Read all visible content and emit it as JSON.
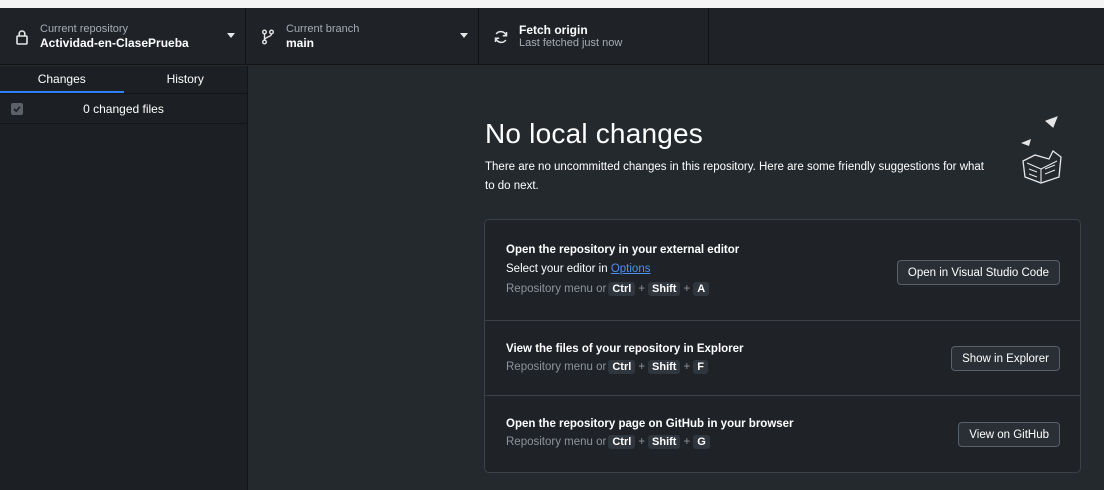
{
  "toolbar": {
    "repo": {
      "label": "Current repository",
      "value": "Actividad-en-ClasePrueba"
    },
    "branch": {
      "label": "Current branch",
      "value": "main"
    },
    "fetch": {
      "label": "Fetch origin",
      "value": "Last fetched just now"
    }
  },
  "sidebar": {
    "tabs": [
      {
        "label": "Changes",
        "active": true
      },
      {
        "label": "History",
        "active": false
      }
    ],
    "changes_label": "0 changed files"
  },
  "main": {
    "heading": "No local changes",
    "subtext": "There are no uncommitted changes in this repository. Here are some friendly suggestions for what to do next.",
    "suggestions": [
      {
        "title": "Open the repository in your external editor",
        "line_prefix": "Select your editor in ",
        "line_link": "Options",
        "hint_prefix": "Repository menu or",
        "keys": [
          "Ctrl",
          "Shift",
          "A"
        ],
        "button": "Open in Visual Studio Code"
      },
      {
        "title": "View the files of your repository in Explorer",
        "hint_prefix": "Repository menu or",
        "keys": [
          "Ctrl",
          "Shift",
          "F"
        ],
        "button": "Show in Explorer"
      },
      {
        "title": "Open the repository page on GitHub in your browser",
        "hint_prefix": "Repository menu or",
        "keys": [
          "Ctrl",
          "Shift",
          "G"
        ],
        "button": "View on GitHub"
      }
    ]
  },
  "icons": {
    "repo": "lock-icon",
    "branch": "git-branch-icon",
    "fetch": "sync-icon",
    "checkbox": "checkbox-icon",
    "illustration": "paper-plane-illustration"
  },
  "colors": {
    "accent": "#2f81f7",
    "link": "#4a90f7",
    "background": "#24292e"
  }
}
